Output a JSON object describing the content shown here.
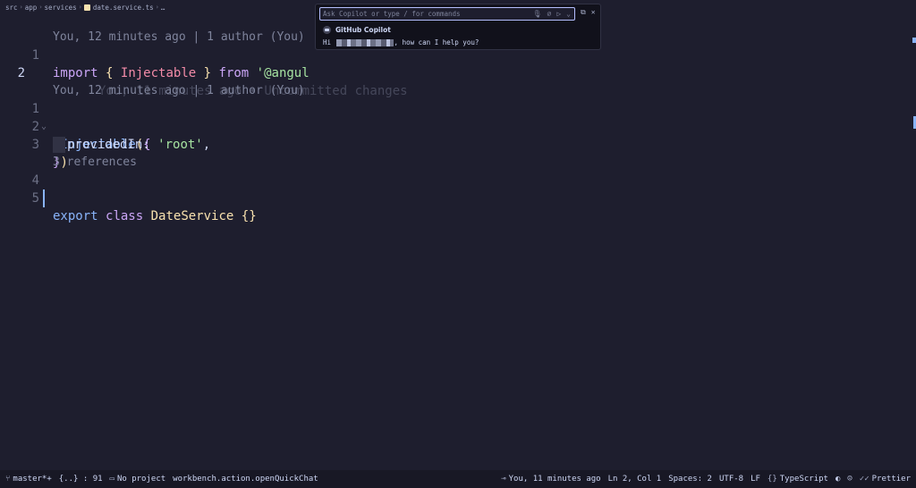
{
  "breadcrumb": {
    "parts": [
      "src",
      "app",
      "services",
      "date.service.ts",
      "…"
    ]
  },
  "codelens": {
    "blame_top": "You, 12 minutes ago | 1 author (You)",
    "blame_inline": "You, 11 minutes ago • Uncommitted changes",
    "blame_class": "You, 12 minutes ago | 1 author (You)",
    "references": "3 references"
  },
  "lines": {
    "l1": {
      "num": "1",
      "import": "import",
      "brace_open": "{",
      "name": "Injectable",
      "brace_close": "}",
      "from": "from",
      "str": "'@angul"
    },
    "l2": {
      "num": "2"
    },
    "l3": {
      "num": "1",
      "decorator": "@Injectable",
      "paren": "(",
      "brace": "{"
    },
    "l4": {
      "num": "2",
      "prop": "providedIn:",
      "str": "'root'",
      "comma": ","
    },
    "l5": {
      "num": "3",
      "brace": "}",
      "paren": ")"
    },
    "l6": {
      "num": "4",
      "export": "export",
      "class": "class",
      "name": "DateService",
      "braces": "{}"
    },
    "l7": {
      "num": "5"
    }
  },
  "quickchat": {
    "placeholder": "Ask Copilot or type / for commands",
    "title": "GitHub Copilot",
    "greeting_prefix": "Hi",
    "greeting_suffix": ", how can I help you?"
  },
  "statusbar": {
    "branch": "master*+",
    "problems": "{..} : 91",
    "project": "No project",
    "command": "workbench.action.openQuickChat",
    "blame": "You, 11 minutes ago",
    "position": "Ln 2, Col 1",
    "spaces": "Spaces: 2",
    "encoding": "UTF-8",
    "eol": "LF",
    "language": "TypeScript",
    "formatter": "Prettier"
  },
  "colors": {
    "background": "#1e1e2e",
    "accent": "#89b4fa",
    "statusbar": "#181825"
  }
}
